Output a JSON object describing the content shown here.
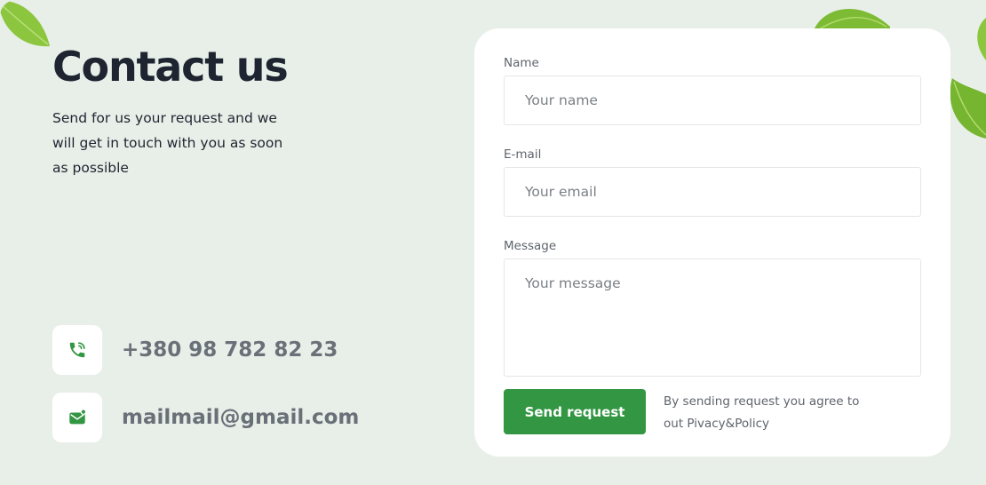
{
  "hero": {
    "title": "Contact us",
    "subtitle": "Send for us your request and we will get in touch with you as soon as possible"
  },
  "contacts": {
    "phone": "+380 98 782 82 23",
    "email": "mailmail@gmail.com",
    "phone_icon": "phone-call-icon",
    "email_icon": "envelope-icon"
  },
  "form": {
    "name_label": "Name",
    "name_placeholder": "Your name",
    "email_label": "E-mail",
    "email_placeholder": "Your email",
    "message_label": "Message",
    "message_placeholder": "Your message",
    "submit_label": "Send request",
    "policy_text": "By sending request you agree to out Pivacy&Policy"
  },
  "colors": {
    "background": "#e8efe8",
    "accent": "#339642",
    "heading": "#1e2430",
    "card": "#ffffff"
  }
}
